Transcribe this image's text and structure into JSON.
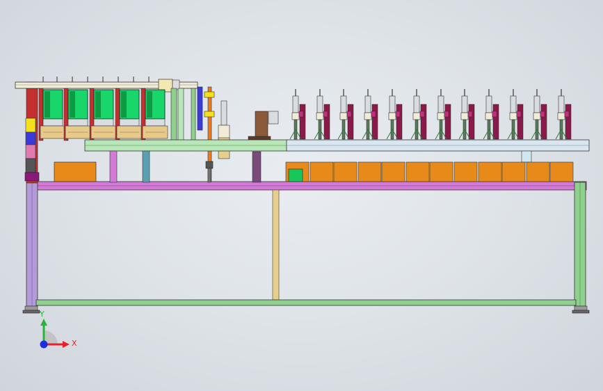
{
  "viewport": {
    "background_top": "#e9edf1",
    "background_bottom": "#cfd5db"
  },
  "triad": {
    "x_label": "X",
    "y_label": "Y",
    "x_color": "#e8202a",
    "y_color": "#27b43b",
    "z_color": "#1b2fe0"
  },
  "colors": {
    "frame_purple": "#b39bd8",
    "frame_green": "#8fd08f",
    "rail_magenta": "#d37ad6",
    "box_orange": "#e88a1a",
    "bin_green": "#18d66a",
    "cylinder_gray": "#d9dde2",
    "accent_red": "#c43030",
    "accent_yellow": "#f3e21a",
    "accent_blue": "#3b3bd8",
    "tan": "#e5cf8a"
  },
  "model": {
    "station_count": 12,
    "orange_box_count": 12,
    "bin_count": 5
  }
}
